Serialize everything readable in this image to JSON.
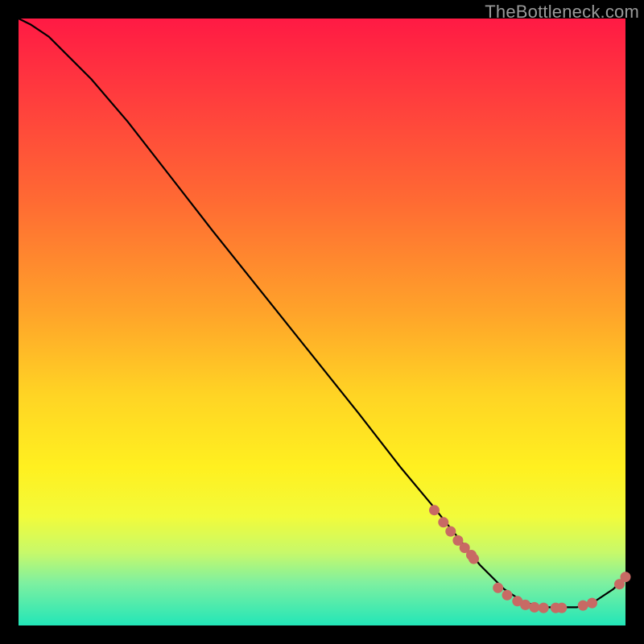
{
  "watermark": "TheBottleneck.com",
  "colors": {
    "curve": "#000000",
    "marker_fill": "#c86a64",
    "marker_stroke": "#c86a64",
    "frame_bg": "#000000"
  },
  "chart_data": {
    "type": "line",
    "title": "",
    "xlabel": "",
    "ylabel": "",
    "xlim": [
      0,
      100
    ],
    "ylim": [
      0,
      100
    ],
    "x": [
      0,
      2,
      5,
      8,
      12,
      18,
      25,
      32,
      40,
      48,
      56,
      63,
      68,
      72,
      76,
      80,
      83,
      86,
      89,
      92,
      95,
      98,
      100
    ],
    "values": [
      100,
      99,
      97,
      94,
      90,
      83,
      74,
      65,
      55,
      45,
      35,
      26,
      20,
      15,
      10,
      6,
      4,
      3,
      3,
      3,
      4,
      6,
      8
    ],
    "markers": {
      "x": [
        68.5,
        70.0,
        71.2,
        72.4,
        73.5,
        74.6,
        75.0,
        79.0,
        80.5,
        82.2,
        83.5,
        85.0,
        86.5,
        88.5,
        89.5,
        93.0,
        94.5,
        99.0,
        100.0
      ],
      "values": [
        19.0,
        17.0,
        15.5,
        14.0,
        12.8,
        11.6,
        11.0,
        6.2,
        5.0,
        4.0,
        3.4,
        3.0,
        2.9,
        2.9,
        2.9,
        3.3,
        3.7,
        6.8,
        8.0
      ]
    }
  }
}
